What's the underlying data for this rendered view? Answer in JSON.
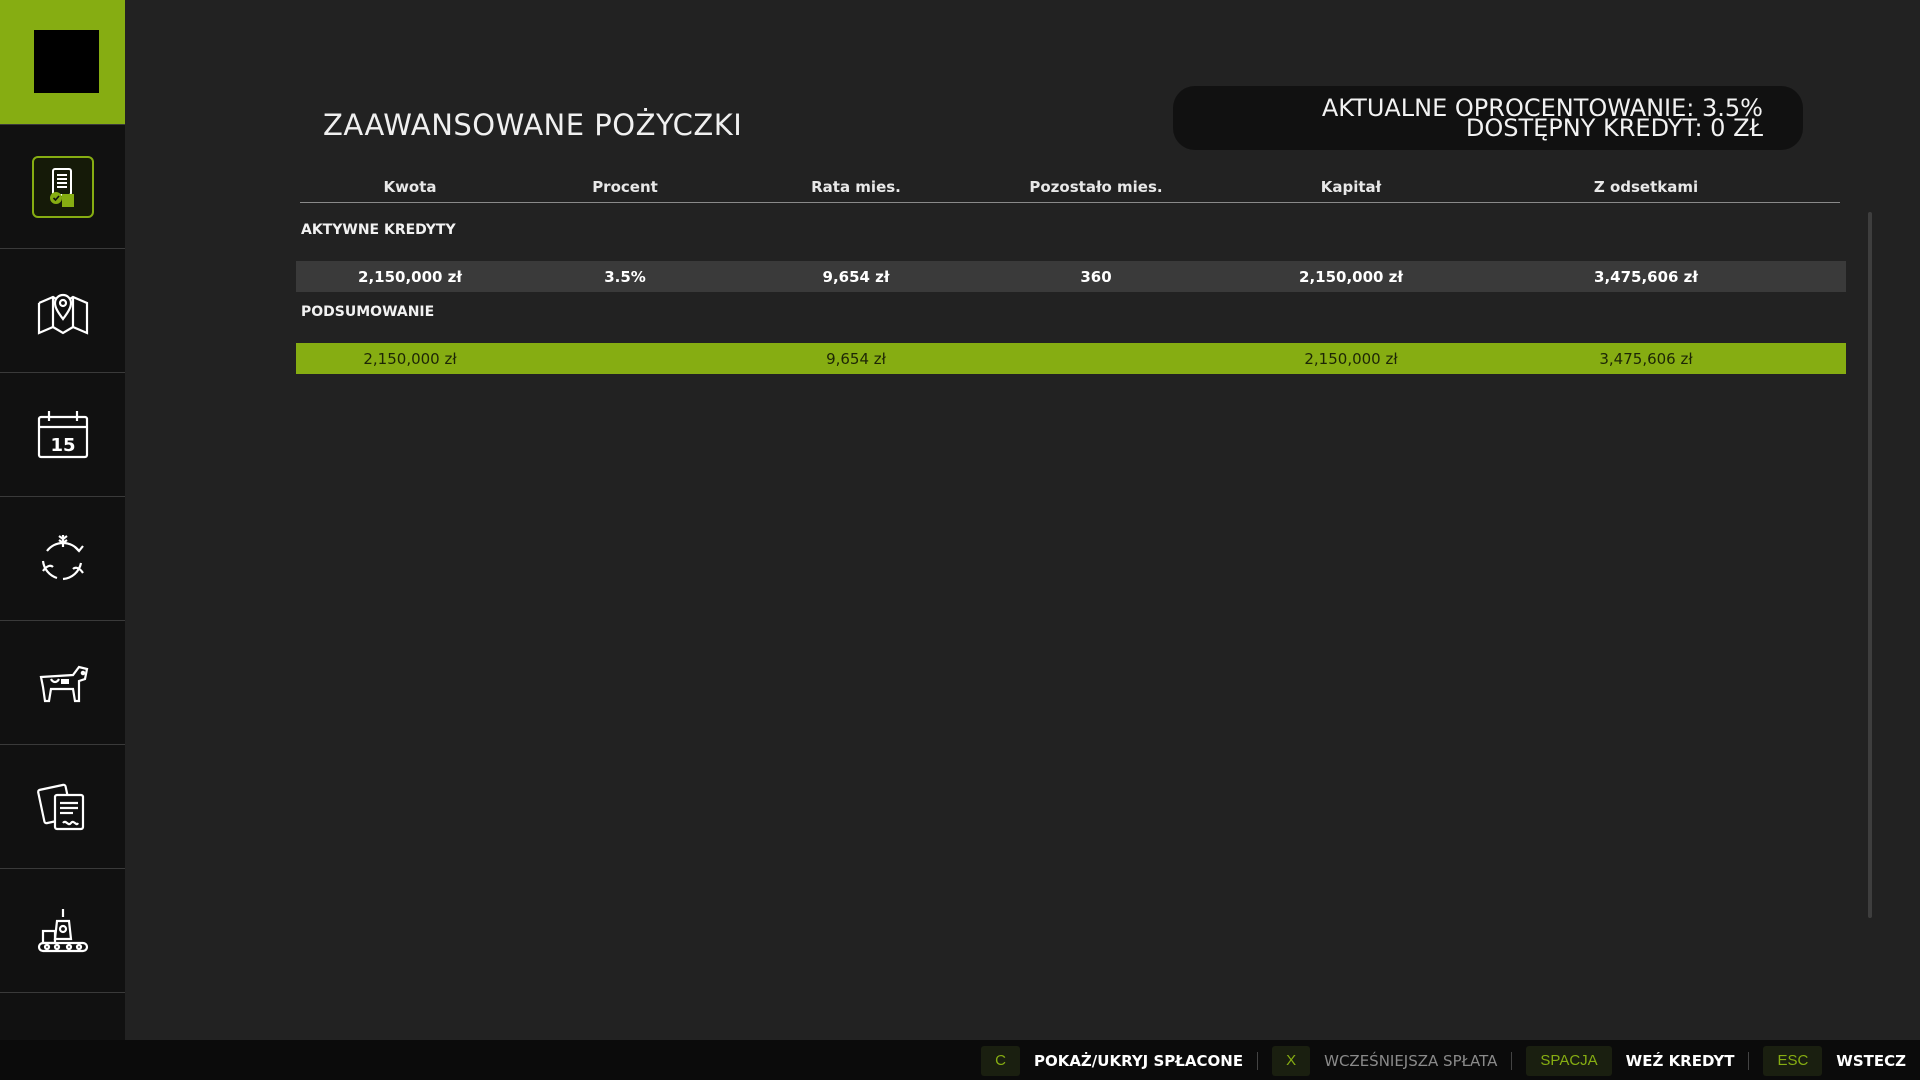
{
  "page": {
    "title": "ZAAWANSOWANE POŻYCZKI",
    "accent_color": "#86ad12"
  },
  "info": {
    "interest_line": "AKTUALNE OPROCENTOWANIE: 3.5%",
    "credit_line": "DOSTĘPNY KREDYT: 0 ZŁ"
  },
  "sidebar": {
    "items": [
      {
        "name": "finances",
        "icon": "document-coins-icon",
        "active": true
      },
      {
        "name": "map",
        "icon": "map-pin-icon"
      },
      {
        "name": "calendar",
        "icon": "calendar-icon"
      },
      {
        "name": "crop-rotation",
        "icon": "cycle-crops-icon"
      },
      {
        "name": "animals",
        "icon": "cow-icon"
      },
      {
        "name": "contracts",
        "icon": "papers-icon"
      },
      {
        "name": "production",
        "icon": "factory-conveyor-icon"
      },
      {
        "name": "more",
        "icon": "check-icon"
      }
    ]
  },
  "table": {
    "columns": [
      "Kwota",
      "Procent",
      "Rata mies.",
      "Pozostało mies.",
      "Kapitał",
      "Z odsetkami"
    ],
    "active_section_label": "AKTYWNE KREDYTY",
    "summary_section_label": "PODSUMOWANIE",
    "loans": [
      {
        "amount": "2,150,000 zł",
        "percent": "3.5%",
        "monthly": "9,654 zł",
        "months_left": "360",
        "capital": "2,150,000 zł",
        "with_interest": "3,475,606 zł"
      }
    ],
    "summary": {
      "amount": "2,150,000 zł",
      "percent": "",
      "monthly": "9,654 zł",
      "months_left": "",
      "capital": "2,150,000 zł",
      "with_interest": "3,475,606 zł"
    }
  },
  "bottom_bar": {
    "actions": [
      {
        "key": "C",
        "label": "POKAŻ/UKRYJ SPŁACONE",
        "enabled": true
      },
      {
        "key": "X",
        "label": "WCZEŚNIEJSZA SPŁATA",
        "enabled": false
      },
      {
        "key": "SPACJA",
        "label": "WEŹ KREDYT",
        "enabled": true
      },
      {
        "key": "ESC",
        "label": "WSTECZ",
        "enabled": true
      }
    ]
  }
}
